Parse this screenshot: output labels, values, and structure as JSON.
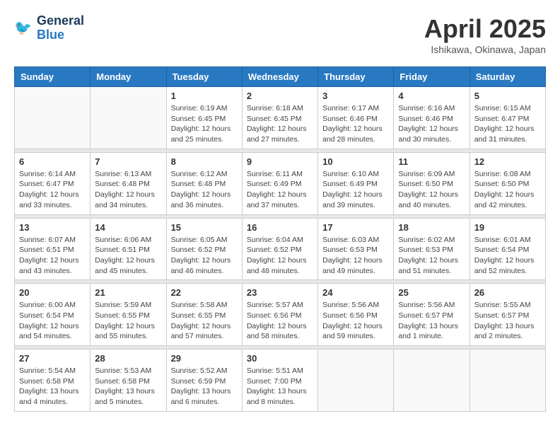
{
  "logo": {
    "line1": "General",
    "line2": "Blue"
  },
  "title": "April 2025",
  "subtitle": "Ishikawa, Okinawa, Japan",
  "weekdays": [
    "Sunday",
    "Monday",
    "Tuesday",
    "Wednesday",
    "Thursday",
    "Friday",
    "Saturday"
  ],
  "weeks": [
    [
      {
        "day": "",
        "info": ""
      },
      {
        "day": "",
        "info": ""
      },
      {
        "day": "1",
        "info": "Sunrise: 6:19 AM\nSunset: 6:45 PM\nDaylight: 12 hours and 25 minutes."
      },
      {
        "day": "2",
        "info": "Sunrise: 6:18 AM\nSunset: 6:45 PM\nDaylight: 12 hours and 27 minutes."
      },
      {
        "day": "3",
        "info": "Sunrise: 6:17 AM\nSunset: 6:46 PM\nDaylight: 12 hours and 28 minutes."
      },
      {
        "day": "4",
        "info": "Sunrise: 6:16 AM\nSunset: 6:46 PM\nDaylight: 12 hours and 30 minutes."
      },
      {
        "day": "5",
        "info": "Sunrise: 6:15 AM\nSunset: 6:47 PM\nDaylight: 12 hours and 31 minutes."
      }
    ],
    [
      {
        "day": "6",
        "info": "Sunrise: 6:14 AM\nSunset: 6:47 PM\nDaylight: 12 hours and 33 minutes."
      },
      {
        "day": "7",
        "info": "Sunrise: 6:13 AM\nSunset: 6:48 PM\nDaylight: 12 hours and 34 minutes."
      },
      {
        "day": "8",
        "info": "Sunrise: 6:12 AM\nSunset: 6:48 PM\nDaylight: 12 hours and 36 minutes."
      },
      {
        "day": "9",
        "info": "Sunrise: 6:11 AM\nSunset: 6:49 PM\nDaylight: 12 hours and 37 minutes."
      },
      {
        "day": "10",
        "info": "Sunrise: 6:10 AM\nSunset: 6:49 PM\nDaylight: 12 hours and 39 minutes."
      },
      {
        "day": "11",
        "info": "Sunrise: 6:09 AM\nSunset: 6:50 PM\nDaylight: 12 hours and 40 minutes."
      },
      {
        "day": "12",
        "info": "Sunrise: 6:08 AM\nSunset: 6:50 PM\nDaylight: 12 hours and 42 minutes."
      }
    ],
    [
      {
        "day": "13",
        "info": "Sunrise: 6:07 AM\nSunset: 6:51 PM\nDaylight: 12 hours and 43 minutes."
      },
      {
        "day": "14",
        "info": "Sunrise: 6:06 AM\nSunset: 6:51 PM\nDaylight: 12 hours and 45 minutes."
      },
      {
        "day": "15",
        "info": "Sunrise: 6:05 AM\nSunset: 6:52 PM\nDaylight: 12 hours and 46 minutes."
      },
      {
        "day": "16",
        "info": "Sunrise: 6:04 AM\nSunset: 6:52 PM\nDaylight: 12 hours and 48 minutes."
      },
      {
        "day": "17",
        "info": "Sunrise: 6:03 AM\nSunset: 6:53 PM\nDaylight: 12 hours and 49 minutes."
      },
      {
        "day": "18",
        "info": "Sunrise: 6:02 AM\nSunset: 6:53 PM\nDaylight: 12 hours and 51 minutes."
      },
      {
        "day": "19",
        "info": "Sunrise: 6:01 AM\nSunset: 6:54 PM\nDaylight: 12 hours and 52 minutes."
      }
    ],
    [
      {
        "day": "20",
        "info": "Sunrise: 6:00 AM\nSunset: 6:54 PM\nDaylight: 12 hours and 54 minutes."
      },
      {
        "day": "21",
        "info": "Sunrise: 5:59 AM\nSunset: 6:55 PM\nDaylight: 12 hours and 55 minutes."
      },
      {
        "day": "22",
        "info": "Sunrise: 5:58 AM\nSunset: 6:55 PM\nDaylight: 12 hours and 57 minutes."
      },
      {
        "day": "23",
        "info": "Sunrise: 5:57 AM\nSunset: 6:56 PM\nDaylight: 12 hours and 58 minutes."
      },
      {
        "day": "24",
        "info": "Sunrise: 5:56 AM\nSunset: 6:56 PM\nDaylight: 12 hours and 59 minutes."
      },
      {
        "day": "25",
        "info": "Sunrise: 5:56 AM\nSunset: 6:57 PM\nDaylight: 13 hours and 1 minute."
      },
      {
        "day": "26",
        "info": "Sunrise: 5:55 AM\nSunset: 6:57 PM\nDaylight: 13 hours and 2 minutes."
      }
    ],
    [
      {
        "day": "27",
        "info": "Sunrise: 5:54 AM\nSunset: 6:58 PM\nDaylight: 13 hours and 4 minutes."
      },
      {
        "day": "28",
        "info": "Sunrise: 5:53 AM\nSunset: 6:58 PM\nDaylight: 13 hours and 5 minutes."
      },
      {
        "day": "29",
        "info": "Sunrise: 5:52 AM\nSunset: 6:59 PM\nDaylight: 13 hours and 6 minutes."
      },
      {
        "day": "30",
        "info": "Sunrise: 5:51 AM\nSunset: 7:00 PM\nDaylight: 13 hours and 8 minutes."
      },
      {
        "day": "",
        "info": ""
      },
      {
        "day": "",
        "info": ""
      },
      {
        "day": "",
        "info": ""
      }
    ]
  ]
}
